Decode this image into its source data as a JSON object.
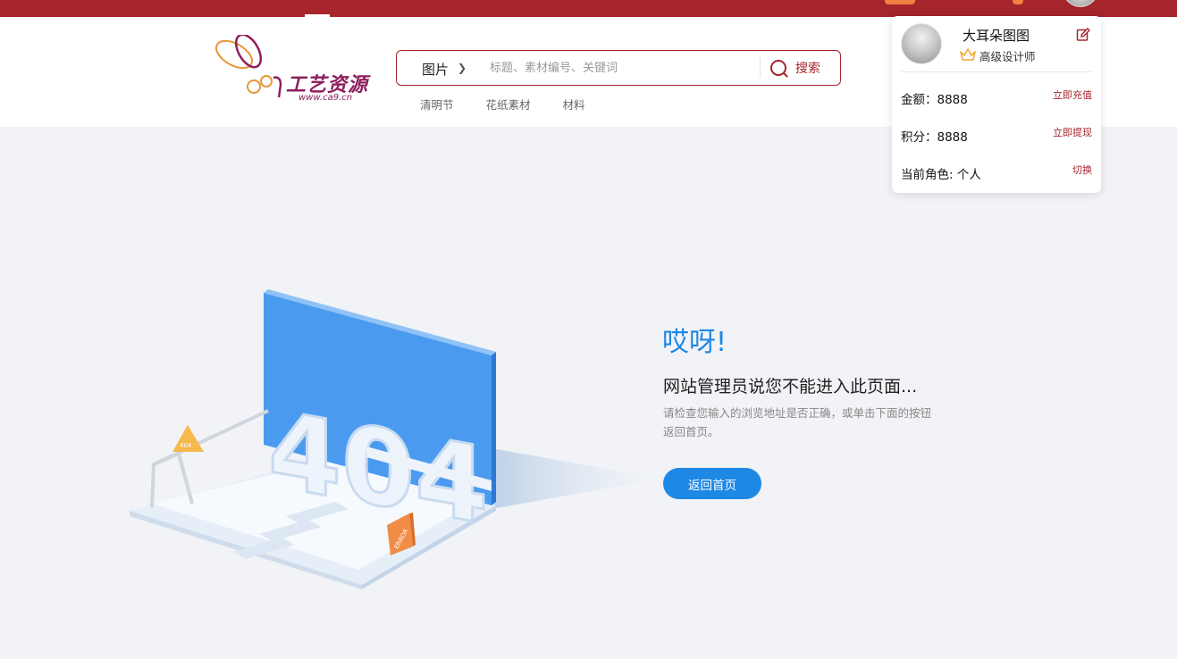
{
  "brand": {
    "logo_text": "工艺资源",
    "logo_url": "www.ca9.cn",
    "accent_color": "#a6242b",
    "primary_blue": "#1e88e5"
  },
  "search": {
    "category": "图片",
    "placeholder": "标题、素材编号、关键词",
    "button_label": "搜索"
  },
  "hot_tags": [
    "清明节",
    "花纸素材",
    "材料"
  ],
  "user": {
    "name": "大耳朵图图",
    "level": "高级设计师",
    "rows": [
      {
        "label": "金额：8888",
        "action": "立即充值"
      },
      {
        "label": "积分：8888",
        "action": "立即提现"
      },
      {
        "label": "当前角色: 个人",
        "action": "切换"
      }
    ]
  },
  "error": {
    "illustration_text": "404",
    "sign_text": "404",
    "error_sign_text": "ERROR",
    "title": "哎呀!",
    "subtitle": "网站管理员说您不能进入此页面...",
    "description": "请检查您输入的浏览地址是否正确，或单击下面的按钮返回首页。",
    "home_button": "返回首页"
  }
}
